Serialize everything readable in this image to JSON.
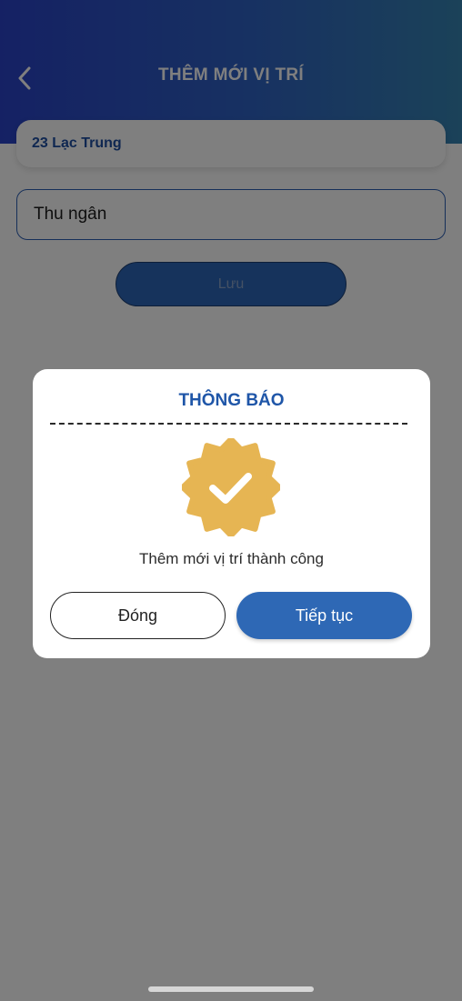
{
  "header": {
    "title": "THÊM MỚI VỊ TRÍ",
    "back_icon": "chevron-left-icon",
    "gradient": [
      "#2a43c8",
      "#3684b2"
    ]
  },
  "location": {
    "name": "23 Lạc Trung"
  },
  "form": {
    "position_name_value": "Thu ngân",
    "save_label": "Lưu"
  },
  "dialog": {
    "title": "THÔNG BÁO",
    "icon": "verified-badge-icon",
    "badge_color": "#e6b553",
    "message": "Thêm mới vị trí thành công",
    "close_label": "Đóng",
    "continue_label": "Tiếp tục",
    "accent": "#2e68b5"
  }
}
